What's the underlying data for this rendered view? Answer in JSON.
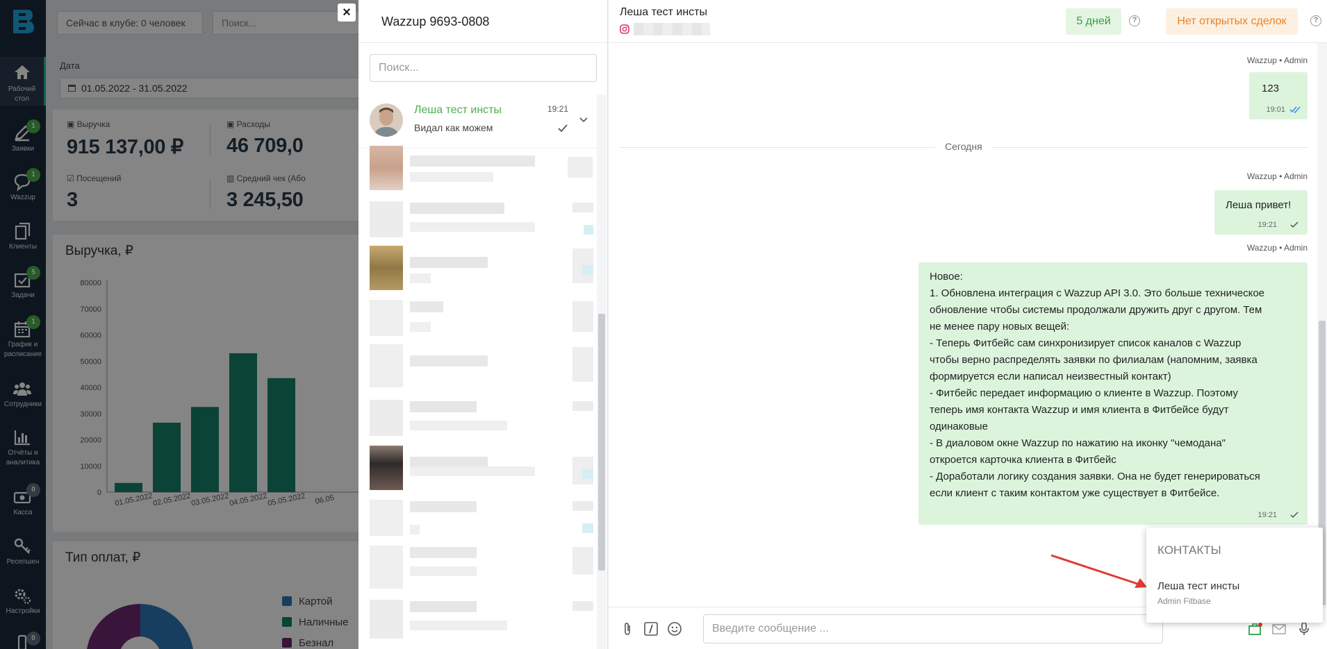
{
  "nav": {
    "items": [
      {
        "label": "Рабочий стол",
        "icon": "home-icon",
        "badge": ""
      },
      {
        "label": "Заявки",
        "icon": "pencil-icon",
        "badge": "1"
      },
      {
        "label": "Wazzup",
        "icon": "chat-bubble-icon",
        "badge": "1"
      },
      {
        "label": "Клиенты",
        "icon": "clients-icon",
        "badge": ""
      },
      {
        "label": "Задачи",
        "icon": "tasks-icon",
        "badge": "5"
      },
      {
        "label": "График и расписание",
        "icon": "calendar-icon",
        "badge": "1"
      },
      {
        "label": "Сотрудники",
        "icon": "people-icon",
        "badge": ""
      },
      {
        "label": "Отчёты и аналитика",
        "icon": "bar-chart-icon",
        "badge": ""
      },
      {
        "label": "Касса",
        "icon": "cash-icon",
        "badge": "0"
      },
      {
        "label": "Ресепшен",
        "icon": "key-icon",
        "badge": ""
      },
      {
        "label": "Настройки",
        "icon": "gears-icon",
        "badge": ""
      },
      {
        "label": "",
        "icon": "phone-icon",
        "badge": "0"
      }
    ]
  },
  "dashboard": {
    "club_now": "Сейчас в клубе: 0 человек",
    "search_placeholder": "Поиск...",
    "date_label": "Дата",
    "date_range": "01.05.2022 - 31.05.2022",
    "stats": {
      "revenue_label": "Выручка",
      "revenue_value": "915 137,00 ₽",
      "expenses_label": "Расходы",
      "expenses_value": "46 709,0",
      "visits_label": "Посещений",
      "visits_value": "3",
      "avg_check_label": "Средний чек (Або",
      "avg_check_value": "3 245,50"
    },
    "revenue_card_title": "Выручка,  ₽",
    "payments_card_title": "Тип оплат,  ₽",
    "payment_legend": [
      {
        "label": "Картой",
        "color": "#2f78b7"
      },
      {
        "label": "Наличные",
        "color": "#16806a"
      },
      {
        "label": "Безнал",
        "color": "#6e2a73"
      }
    ],
    "colors": {
      "bar": "#16806a",
      "accent": "#1ec0a8"
    }
  },
  "chart_data": {
    "type": "bar",
    "title": "Выручка,  ₽",
    "categories": [
      "01.05.2022",
      "02.05.2022",
      "03.05.2022",
      "04.05.2022",
      "05.05.2022",
      "06.05"
    ],
    "values": [
      3500,
      26500,
      32500,
      53000,
      43500,
      0
    ],
    "y_ticks": [
      "0",
      "10000",
      "20000",
      "30000",
      "40000",
      "50000",
      "60000",
      "70000",
      "80000"
    ],
    "ylim": [
      0,
      80000
    ],
    "grid": false
  },
  "chat": {
    "close_label": "×",
    "channel_title": "Wazzup 9693-0808",
    "search_placeholder": "Поиск...",
    "active_contact": {
      "name": "Леша тест инсты",
      "preview": "Видал как можем",
      "time": "19:21"
    },
    "header": {
      "contact_name": "Леша тест инсты",
      "days_badge": "5 дней",
      "deals_badge": "Нет открытых сделок",
      "help": "?"
    },
    "messages": [
      {
        "meta": "Wazzup • Admin",
        "text": "123",
        "time": "19:01",
        "status": "read"
      },
      {
        "meta": "Wazzup • Admin",
        "text": "Леша привет!",
        "time": "19:21",
        "status": "sent"
      },
      {
        "meta": "Wazzup • Admin",
        "text": "Новое:\n1. Обновлена интеграция с Wazzup API 3.0. Это больше техническое\nобновление чтобы системы продолжали дружить друг с другом. Тем\nне менее пару новых вещей:\n- Теперь Фитбейс сам синхронизирует список каналов с Wazzup\nчтобы верно распределять заявки по филиалам (напомним, заявка\nформируется если написал неизвестный контакт)\n- Фитбейс передает информацию о клиенте в Wazzup. Поэтому\nтеперь имя контакта Wazzup и имя клиента в Фитбейсе будут\nодинаковые\n- В диаловом окне Wazzup по нажатию на иконку \"чемодана\"\nоткроется карточка клиента в Фитбейс\n- Доработали логику создания заявки. Она не будет генерироваться\nесли клиент с таким контактом уже существует в Фитбейсе.",
        "time": "19:21",
        "status": "sent"
      }
    ],
    "day_separator": "Сегодня",
    "composer_placeholder": "Введите сообщение ...",
    "contacts_popup": {
      "title": "КОНТАКТЫ",
      "name": "Леша тест инсты",
      "subtitle": "Admin Fitbase"
    },
    "colors": {
      "green_text": "#4caf50",
      "bubble": "#dcf4dc",
      "days_bg": "#e4f5e4",
      "deals_bg": "#fdf0e0",
      "deals_text": "#e8822a"
    }
  }
}
